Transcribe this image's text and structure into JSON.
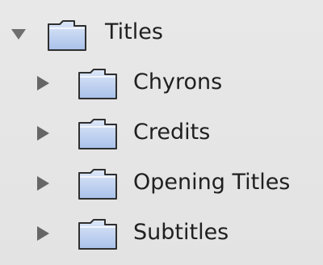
{
  "folder_tree": {
    "root": {
      "label": "Titles",
      "expanded": true,
      "icon": "folder-icon",
      "children": [
        {
          "label": "Chyrons",
          "expanded": false,
          "icon": "folder-icon"
        },
        {
          "label": "Credits",
          "expanded": false,
          "icon": "folder-icon"
        },
        {
          "label": "Opening Titles",
          "expanded": false,
          "icon": "folder-icon"
        },
        {
          "label": "Subtitles",
          "expanded": false,
          "icon": "folder-icon"
        }
      ]
    },
    "colors": {
      "background": "#e6e6e6",
      "triangle": "#6b6b6b",
      "folder_fill": "#c9d8f2",
      "folder_outline": "#2f2f2f",
      "text": "#202020"
    }
  }
}
